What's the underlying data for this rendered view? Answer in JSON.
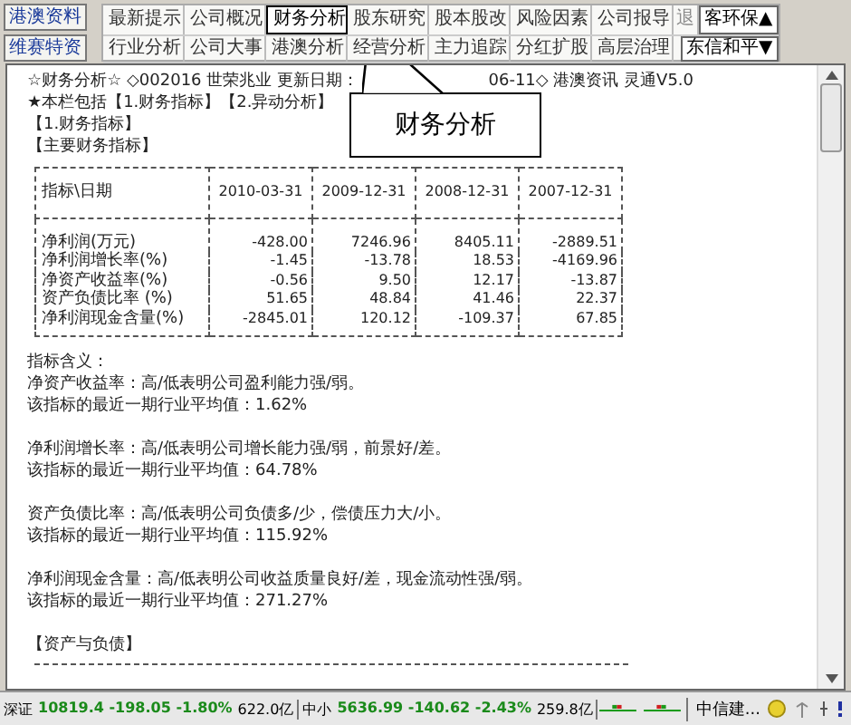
{
  "side_buttons": [
    "港澳资料",
    "维赛特资"
  ],
  "tab_rows": [
    [
      {
        "label": "最新提示",
        "selected": false,
        "disabled": false
      },
      {
        "label": "公司概况",
        "selected": false,
        "disabled": false
      },
      {
        "label": "财务分析",
        "selected": true,
        "disabled": false
      },
      {
        "label": "股东研究",
        "selected": false,
        "disabled": false
      },
      {
        "label": "股本股改",
        "selected": false,
        "disabled": false
      },
      {
        "label": "风险因素",
        "selected": false,
        "disabled": false
      },
      {
        "label": "公司报导",
        "selected": false,
        "disabled": false
      },
      {
        "label": "退",
        "selected": false,
        "disabled": true
      }
    ],
    [
      {
        "label": "行业分析",
        "selected": false,
        "disabled": false
      },
      {
        "label": "公司大事",
        "selected": false,
        "disabled": false
      },
      {
        "label": "港澳分析",
        "selected": false,
        "disabled": false
      },
      {
        "label": "经营分析",
        "selected": false,
        "disabled": false
      },
      {
        "label": "主力追踪",
        "selected": false,
        "disabled": false
      },
      {
        "label": "分红扩股",
        "selected": false,
        "disabled": false
      },
      {
        "label": "高层治理",
        "selected": false,
        "disabled": false
      }
    ]
  ],
  "stock_buttons": [
    "客环保▲",
    "东信和平▼"
  ],
  "header_line": [
    "☆财务分析☆ ◇002016 世荣兆业 更新日期：",
    "06-11◇ 港澳资讯 灵通V5.0"
  ],
  "contents_line": "★本栏包括【1.财务指标】【2.异动分析】",
  "section_titles": [
    "【1.财务指标】",
    "【主要财务指标】"
  ],
  "table": {
    "columns": [
      "指标\\日期",
      "2010-03-31",
      "2009-12-31",
      "2008-12-31",
      "2007-12-31"
    ],
    "rows": [
      {
        "label": "净利润(万元)",
        "values": [
          "-428.00",
          "7246.96",
          "8405.11",
          "-2889.51"
        ]
      },
      {
        "label": "净利润增长率(%)",
        "values": [
          "-1.45",
          "-13.78",
          "18.53",
          "-4169.96"
        ]
      },
      {
        "label": "净资产收益率(%)",
        "values": [
          "-0.56",
          "9.50",
          "12.17",
          "-13.87"
        ]
      },
      {
        "label": "资产负债比率 (%)",
        "values": [
          "51.65",
          "48.84",
          "41.46",
          "22.37"
        ]
      },
      {
        "label": "净利润现金含量(%)",
        "values": [
          "-2845.01",
          "120.12",
          "-109.37",
          "67.85"
        ]
      }
    ]
  },
  "notes": {
    "title": "指标含义：",
    "items": [
      {
        "definition": "净资产收益率：高/低表明公司盈利能力强/弱。",
        "average": "该指标的最近一期行业平均值：1.62%"
      },
      {
        "definition": "净利润增长率：高/低表明公司增长能力强/弱，前景好/差。",
        "average": "该指标的最近一期行业平均值：64.78%"
      },
      {
        "definition": "资产负债比率：高/低表明公司负债多/少，偿债压力大/小。",
        "average": "该指标的最近一期行业平均值：115.92%"
      },
      {
        "definition": "净利润现金含量：高/低表明公司收益质量良好/差，现金流动性强/弱。",
        "average": "该指标的最近一期行业平均值：271.27%"
      }
    ]
  },
  "next_section": "【资产与负债】",
  "callout": "财务分析",
  "status_bar": {
    "indexes": [
      {
        "name": "深证",
        "quote": "10819.4 -198.05 -1.80%",
        "turnover": "622.0亿"
      },
      {
        "name": "中小",
        "quote": "5636.99 -140.62 -2.43%",
        "turnover": "259.8亿"
      }
    ],
    "broker": "中信建..."
  }
}
